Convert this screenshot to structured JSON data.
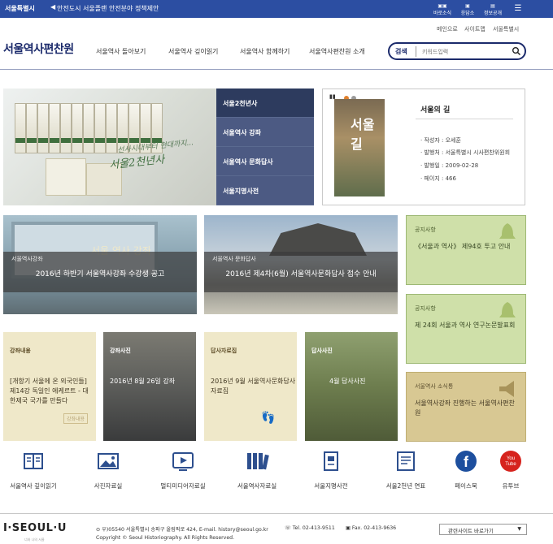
{
  "topbar": {
    "logo": "서울특별시",
    "notice": "안전도시 서울플랜 안전분야 정책제안",
    "quick_links": [
      "바로소식",
      "응답소",
      "정보공개",
      "메뉴"
    ]
  },
  "util_links": [
    "메인으로",
    "사이트맵",
    "서울특별시"
  ],
  "header": {
    "site_title": "서울역사편찬원",
    "nav": [
      "서울역사 돌아보기",
      "서울역사 깊이읽기",
      "서울역사 함께하기",
      "서울역사편찬원 소개"
    ],
    "search": {
      "label": "검색",
      "placeholder": "키워드입력"
    }
  },
  "hero": {
    "caption_small": "선사시대부터 현대까지...",
    "caption": "서울2천년사",
    "tabs": [
      "서울2천년사",
      "서울역사 강좌",
      "서울역사 문화답사",
      "서울지명사전"
    ]
  },
  "book": {
    "cover_text": "서울 길",
    "title": "서울의 길",
    "meta": [
      "작성자 : 오세훈",
      "발행처 : 서울특별시 시사편찬위원회",
      "발행일 : 2009-02-28",
      "페이지 : 466"
    ]
  },
  "banners": [
    {
      "category": "서울역사강좌",
      "title": "2016년 하반기 서울역사강좌 수강생 공고",
      "watermark": "서울 역사 강좌"
    },
    {
      "category": "서울역사 문화답사",
      "title": "2016년 제4차(6월) 서울역사문화답사 접수 안내"
    }
  ],
  "notices": [
    {
      "category": "공지사항",
      "text": "《서울과 역사》 제94호 투고 안내"
    },
    {
      "category": "공지사항",
      "text": "제 24회 서울과 역사 연구논문발표회"
    },
    {
      "category": "서울역사 소식통",
      "text": "서울역사강좌 진행하는 서울역사편찬원"
    }
  ],
  "cards": [
    {
      "category": "강좌내용",
      "text": "[개항기 서울에 온 외국인들] 제14강 독일인 에케르트 - 대한제국 국가를 만들다",
      "badge": "강좌내용"
    },
    {
      "category": "강좌사진",
      "text": "2016년 8월 26일 강좌"
    },
    {
      "category": "답사자료집",
      "text": "2016년 9월 서울역사문화답사자료집"
    },
    {
      "category": "답사사진",
      "text": "4월 답사사진"
    }
  ],
  "quick_icons": [
    {
      "label": "서울역사 깊이읽기",
      "icon": "book-list-icon"
    },
    {
      "label": "사진자료실",
      "icon": "photo-icon"
    },
    {
      "label": "멀티미디어자료실",
      "icon": "video-icon"
    },
    {
      "label": "서울역사자료실",
      "icon": "archive-icon"
    },
    {
      "label": "서울지명사전",
      "icon": "dictionary-icon"
    },
    {
      "label": "서울2천년 연표",
      "icon": "timeline-icon"
    },
    {
      "label": "페이스북",
      "icon": "facebook-icon"
    },
    {
      "label": "유투브",
      "icon": "youtube-icon"
    }
  ],
  "footer": {
    "logo": "I·SEOUL·U",
    "logo_sub": "너와 나의 서울",
    "address": "우)05540 서울특별시 송파구 올림픽로 424, E-mail. history@seoul.go.kr",
    "tel": "Tel. 02-413-9511",
    "fax": "Fax. 02-413-9636",
    "copyright": "Copyright © Seoul Historiography. All Rights Reserved.",
    "related_sites": "관련사이트 바로가기"
  },
  "colors": {
    "topbar": "#2c4ea2",
    "hero_tab_active": "#2d3b5e",
    "hero_tab": "#4c5a83",
    "notice_green": "#cfe0a9",
    "notice_tan": "#d8c893",
    "card_cream": "#efe8c9"
  }
}
